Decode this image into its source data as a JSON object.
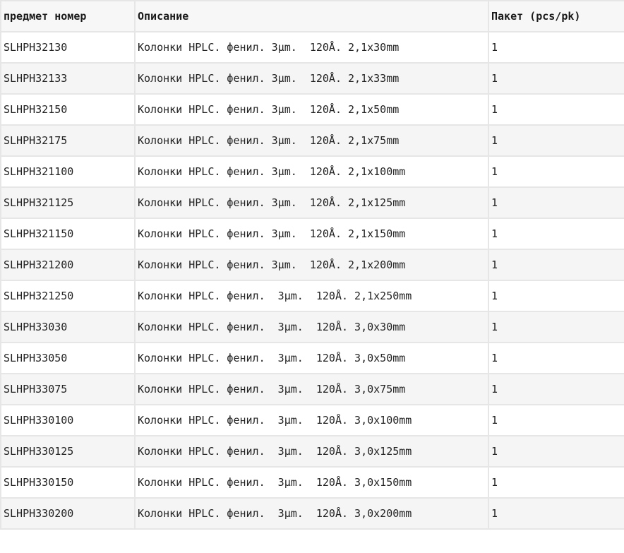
{
  "table": {
    "headers": [
      "предмет номер",
      "Описание",
      "Пакет (pcs/pk)"
    ],
    "rows": [
      [
        "SLHPH32130",
        "Колонки HPLC. фенил. 3μm.  120Å. 2,1x30mm",
        "1"
      ],
      [
        "SLHPH32133",
        "Колонки HPLC. фенил. 3μm.  120Å. 2,1x33mm",
        "1"
      ],
      [
        "SLHPH32150",
        "Колонки HPLC. фенил. 3μm.  120Å. 2,1x50mm",
        "1"
      ],
      [
        "SLHPH32175",
        "Колонки HPLC. фенил. 3μm.  120Å. 2,1x75mm",
        "1"
      ],
      [
        "SLHPH321100",
        "Колонки HPLC. фенил. 3μm.  120Å. 2,1x100mm",
        "1"
      ],
      [
        "SLHPH321125",
        "Колонки HPLC. фенил. 3μm.  120Å. 2,1x125mm",
        "1"
      ],
      [
        "SLHPH321150",
        "Колонки HPLC. фенил. 3μm.  120Å. 2,1x150mm",
        "1"
      ],
      [
        "SLHPH321200",
        "Колонки HPLC. фенил. 3μm.  120Å. 2,1x200mm",
        "1"
      ],
      [
        "SLHPH321250",
        "Колонки HPLC. фенил.  3μm.  120Å. 2,1x250mm",
        "1"
      ],
      [
        "SLHPH33030",
        "Колонки HPLC. фенил.  3μm.  120Å. 3,0x30mm",
        "1"
      ],
      [
        "SLHPH33050",
        "Колонки HPLC. фенил.  3μm.  120Å. 3,0x50mm",
        "1"
      ],
      [
        "SLHPH33075",
        "Колонки HPLC. фенил.  3μm.  120Å. 3,0x75mm",
        "1"
      ],
      [
        "SLHPH330100",
        "Колонки HPLC. фенил.  3μm.  120Å. 3,0x100mm",
        "1"
      ],
      [
        "SLHPH330125",
        "Колонки HPLC. фенил.  3μm.  120Å. 3,0x125mm",
        "1"
      ],
      [
        "SLHPH330150",
        "Колонки HPLC. фенил.  3μm.  120Å. 3,0x150mm",
        "1"
      ],
      [
        "SLHPH330200",
        "Колонки HPLC. фенил.  3μm.  120Å. 3,0x200mm",
        "1"
      ]
    ]
  }
}
